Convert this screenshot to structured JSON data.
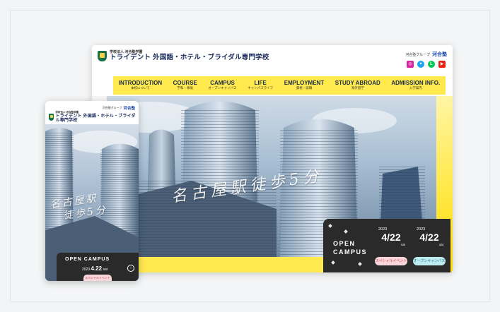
{
  "desktop": {
    "logo": {
      "subtitle": "学校法人 河合塾学園",
      "title": "トライデント 外国語・ホテル・ブライダル専門学校"
    },
    "group": {
      "label": "河合塾グループ",
      "mark": "河合塾"
    },
    "socials": [
      {
        "name": "instagram-icon",
        "glyph": "◎"
      },
      {
        "name": "twitter-icon",
        "glyph": "✦"
      },
      {
        "name": "line-icon",
        "glyph": "L"
      },
      {
        "name": "youtube-icon",
        "glyph": "▶"
      }
    ],
    "nav": [
      {
        "en": "INTRODUCTION",
        "jp": "本校について"
      },
      {
        "en": "COURSE",
        "jp": "学科・専攻"
      },
      {
        "en": "CAMPUS",
        "jp": "オープンキャンパス"
      },
      {
        "en": "LIFE",
        "jp": "キャンパスライフ"
      },
      {
        "en": "EMPLOYMENT",
        "jp": "資格・就職"
      },
      {
        "en": "STUDY ABROAD",
        "jp": "海外留学"
      },
      {
        "en": "ADMISSION INFO.",
        "jp": "入学案内"
      }
    ],
    "hero_copy": "名古屋駅徒歩5分",
    "open_campus": {
      "title": "OPEN CAMPUS",
      "events": [
        {
          "year": "2023",
          "date": "4/22",
          "day": "sat",
          "tag": "スペシャルイベント",
          "tag_color": "#f9d6da"
        },
        {
          "year": "2023",
          "date": "4/22",
          "day": "sat",
          "tag": "オープンキャンパス",
          "tag_color": "#bfecf0"
        }
      ]
    }
  },
  "mobile": {
    "group": {
      "label": "河合塾グループ",
      "mark": "河合塾"
    },
    "logo": {
      "subtitle": "学校法人 河合塾学園",
      "title": "トライデント 外国語・ホテル・ブライダル専門学校"
    },
    "hero_copy_line1": "名古屋駅",
    "hero_copy_line2": "徒歩5分",
    "open_campus": {
      "title": "OPEN CAMPUS",
      "year": "2023",
      "date": "4.22",
      "day": "sat",
      "tag": "スペシャルイベント"
    }
  },
  "colors": {
    "nav_yellow": "#ffe94d",
    "logo_navy": "#1a2a5a",
    "crest_green": "#14734a",
    "card_dark": "#2a2a2a"
  }
}
